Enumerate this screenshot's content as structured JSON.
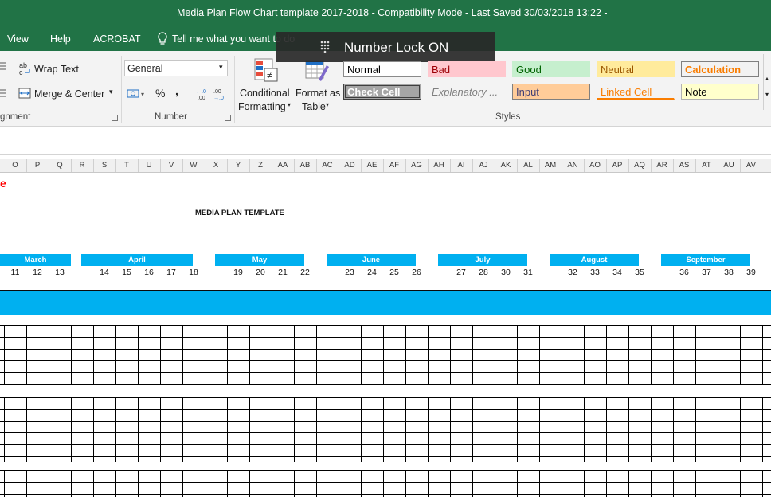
{
  "window": {
    "title": "Media Plan Flow Chart template 2017-2018  -  Compatibility Mode  -  Last Saved 30/03/2018 13:22  -"
  },
  "menu": {
    "items": [
      "View",
      "Help",
      "ACROBAT"
    ],
    "tell_me": "Tell me what you want to do"
  },
  "ribbon": {
    "alignment": {
      "wrap_text": "Wrap Text",
      "merge_center": "Merge & Center",
      "group_label": "gnment"
    },
    "number": {
      "format": "General",
      "percent": "%",
      "comma": ",",
      "inc_decimal": "←.0\n.00",
      "group_label": "Number"
    },
    "styles": {
      "conditional_formatting": [
        "Conditional",
        "Formatting"
      ],
      "format_as_table": [
        "Format as",
        "Table"
      ],
      "group_label": "Styles",
      "cells": [
        {
          "label": "Normal",
          "bg": "#ffffff",
          "fg": "#000000",
          "border": "#8a8a8a"
        },
        {
          "label": "Bad",
          "bg": "#ffc7ce",
          "fg": "#9c0006",
          "border": "#ffc7ce"
        },
        {
          "label": "Good",
          "bg": "#c6efce",
          "fg": "#006100",
          "border": "#c6efce"
        },
        {
          "label": "Neutral",
          "bg": "#ffeb9c",
          "fg": "#9c5700",
          "border": "#ffeb9c"
        },
        {
          "label": "Calculation",
          "bg": "#f2f2f2",
          "fg": "#fa7d00",
          "border": "#7f7f7f"
        },
        {
          "label": "Check Cell",
          "bg": "#a5a5a5",
          "fg": "#ffffff",
          "border": "#3f3f3f"
        },
        {
          "label": "Explanatory ...",
          "bg": "#f3f3f3",
          "fg": "#7f7f7f",
          "border": "#f3f3f3"
        },
        {
          "label": "Input",
          "bg": "#ffcc99",
          "fg": "#3f3f76",
          "border": "#7f7f7f"
        },
        {
          "label": "Linked Cell",
          "bg": "#f3f3f3",
          "fg": "#fa7d00",
          "border": "#f3f3f3"
        },
        {
          "label": "Note",
          "bg": "#ffffcc",
          "fg": "#000000",
          "border": "#b2b2b2"
        }
      ]
    }
  },
  "columns": [
    "O",
    "P",
    "Q",
    "R",
    "S",
    "T",
    "U",
    "V",
    "W",
    "X",
    "Y",
    "Z",
    "AA",
    "AB",
    "AC",
    "AD",
    "AE",
    "AF",
    "AG",
    "AH",
    "AI",
    "AJ",
    "AK",
    "AL",
    "AM",
    "AN",
    "AO",
    "AP",
    "AQ",
    "AR",
    "AS",
    "AT",
    "AU",
    "AV"
  ],
  "sheet": {
    "title": "MEDIA PLAN TEMPLATE",
    "red_fragment": "e",
    "months": [
      {
        "name": "March",
        "weeks": [
          "11",
          "12",
          "13"
        ]
      },
      {
        "name": "April",
        "weeks": [
          "14",
          "15",
          "16",
          "17",
          "18"
        ]
      },
      {
        "name": "May",
        "weeks": [
          "19",
          "20",
          "21",
          "22"
        ]
      },
      {
        "name": "June",
        "weeks": [
          "23",
          "24",
          "25",
          "26"
        ]
      },
      {
        "name": "July",
        "weeks": [
          "27",
          "28",
          "30",
          "31"
        ]
      },
      {
        "name": "August",
        "weeks": [
          "32",
          "33",
          "34",
          "35"
        ]
      },
      {
        "name": "September",
        "weeks": [
          "36",
          "37",
          "38",
          "39"
        ]
      }
    ],
    "accent": "#00b0f0"
  },
  "toast": {
    "text": "Number Lock ON"
  }
}
